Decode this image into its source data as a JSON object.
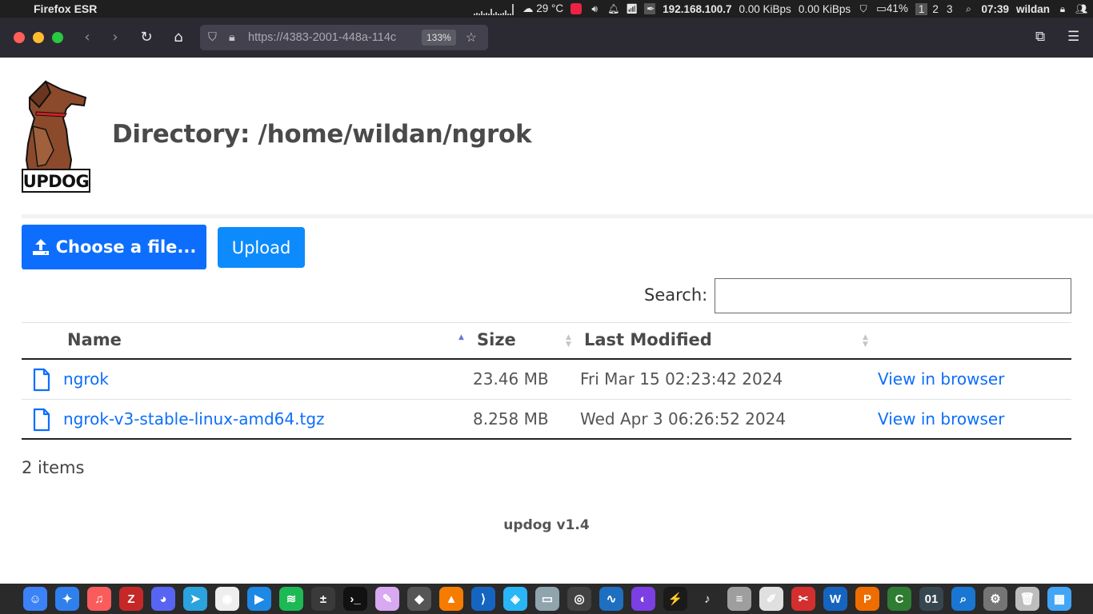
{
  "system_bar": {
    "app_name": "Firefox ESR",
    "weather": "29 °C",
    "ip": "192.168.100.7",
    "net_down": "0.00 KiBps",
    "net_up": "0.00 KiBps",
    "battery": "41%",
    "workspaces": [
      "1",
      "2",
      "3"
    ],
    "active_workspace": "1",
    "time": "07:39",
    "user": "wildan"
  },
  "browser": {
    "url": "https://4383-2001-448a-114c",
    "zoom": "133%"
  },
  "page": {
    "directory_title": "Directory: /home/wildan/ngrok",
    "logo_text": "UPDOG",
    "choose_file_label": "Choose a file...",
    "upload_label": "Upload",
    "search_label": "Search:",
    "search_value": "",
    "columns": {
      "name": "Name",
      "size": "Size",
      "modified": "Last Modified"
    },
    "files": [
      {
        "name": "ngrok",
        "size": "23.46 MB",
        "modified": "Fri Mar 15 02:23:42 2024",
        "action": "View in browser"
      },
      {
        "name": "ngrok-v3-stable-linux-amd64.tgz",
        "size": "8.258 MB",
        "modified": "Wed Apr 3 06:26:52 2024",
        "action": "View in browser"
      }
    ],
    "items_count": "2 items",
    "footer": "updog v1.4"
  },
  "colors": {
    "primary": "#0d6efd",
    "upload_button": "#0d8bfd",
    "dog_red_collar": "#d32020",
    "dog_brown": "#8b4a2b"
  },
  "dock": {
    "apps": [
      {
        "name": "finder-icon",
        "color": "#3b82f6",
        "glyph": "☺"
      },
      {
        "name": "safari-icon",
        "color": "#2f80ed",
        "glyph": "✦"
      },
      {
        "name": "music-icon",
        "color": "#fa5c5c",
        "glyph": "♫"
      },
      {
        "name": "filezilla-icon",
        "color": "#c62828",
        "glyph": "Z"
      },
      {
        "name": "discord-icon",
        "color": "#5865f2",
        "glyph": "◕"
      },
      {
        "name": "telegram-icon",
        "color": "#2aa3de",
        "glyph": "➤"
      },
      {
        "name": "camera-icon",
        "color": "#eeeeee",
        "glyph": "◉"
      },
      {
        "name": "media-player-icon",
        "color": "#1e88e5",
        "glyph": "▶"
      },
      {
        "name": "spotify-icon",
        "color": "#1db954",
        "glyph": "≋"
      },
      {
        "name": "calculator-icon",
        "color": "#3a3a3a",
        "glyph": "±"
      },
      {
        "name": "terminal-icon",
        "color": "#111111",
        "glyph": "›_"
      },
      {
        "name": "inkscape-icon",
        "color": "#d8a8f0",
        "glyph": "✎"
      },
      {
        "name": "spy-icon",
        "color": "#555555",
        "glyph": "◆"
      },
      {
        "name": "vlc-icon",
        "color": "#f57c00",
        "glyph": "▲"
      },
      {
        "name": "vscode-icon",
        "color": "#1565c0",
        "glyph": "⟩"
      },
      {
        "name": "box-icon",
        "color": "#29b6f6",
        "glyph": "◈"
      },
      {
        "name": "drive-icon",
        "color": "#90a4ae",
        "glyph": "▭"
      },
      {
        "name": "screenshot-icon",
        "color": "#424242",
        "glyph": "◎"
      },
      {
        "name": "wireshark-icon",
        "color": "#1e6fbf",
        "glyph": "∿"
      },
      {
        "name": "firefox-dev-icon",
        "color": "#7b3fe4",
        "glyph": "◐"
      },
      {
        "name": "bolt-icon",
        "color": "#1a1a1a",
        "glyph": "⚡"
      },
      {
        "name": "itunes-icon",
        "color": "#2a2a2a",
        "glyph": "♪"
      },
      {
        "name": "database-icon",
        "color": "#9e9e9e",
        "glyph": "≡"
      },
      {
        "name": "editor-icon",
        "color": "#e0e0e0",
        "glyph": "✐"
      },
      {
        "name": "pdf-icon",
        "color": "#d32f2f",
        "glyph": "✂"
      },
      {
        "name": "writer-icon",
        "color": "#1565c0",
        "glyph": "W"
      },
      {
        "name": "impress-icon",
        "color": "#ef6c00",
        "glyph": "P"
      },
      {
        "name": "calc-icon",
        "color": "#2e7d32",
        "glyph": "C"
      },
      {
        "name": "binary-icon",
        "color": "#37474f",
        "glyph": "01"
      },
      {
        "name": "search-icon",
        "color": "#1976d2",
        "glyph": "⌕"
      },
      {
        "name": "settings-icon",
        "color": "#757575",
        "glyph": "⚙"
      },
      {
        "name": "trash-icon",
        "color": "#bdbdbd",
        "glyph": "🗑"
      },
      {
        "name": "apps-folder-icon",
        "color": "#42a5f5",
        "glyph": "▦"
      }
    ]
  }
}
